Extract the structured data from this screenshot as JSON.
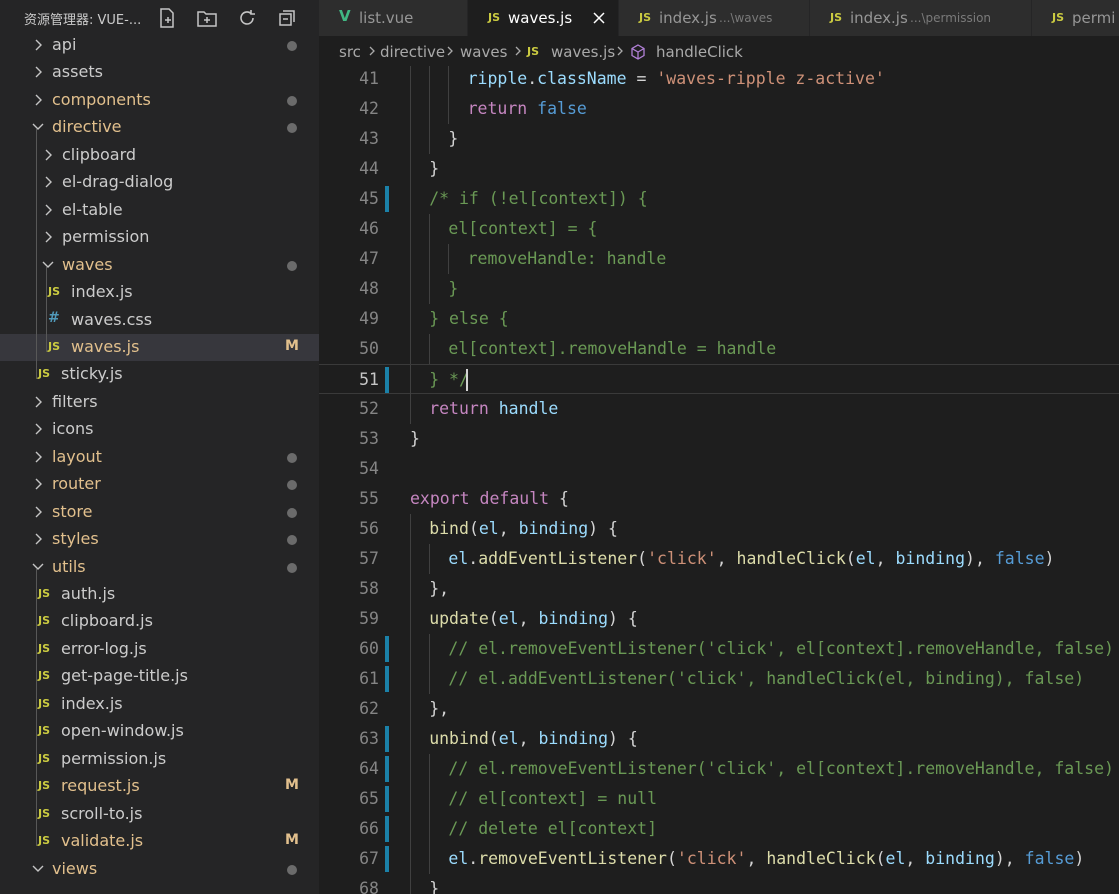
{
  "sidebar": {
    "title": "资源管理器: VUE-...",
    "tree": [
      {
        "label": "api",
        "type": "folder",
        "open": false,
        "depth": 1,
        "status": "dot"
      },
      {
        "label": "assets",
        "type": "folder",
        "open": false,
        "depth": 1,
        "status": ""
      },
      {
        "label": "components",
        "type": "folder",
        "open": false,
        "depth": 1,
        "status": "dot",
        "modified": true
      },
      {
        "label": "directive",
        "type": "folder",
        "open": true,
        "depth": 1,
        "status": "dot",
        "modified": true
      },
      {
        "label": "clipboard",
        "type": "folder",
        "open": false,
        "depth": 2,
        "status": ""
      },
      {
        "label": "el-drag-dialog",
        "type": "folder",
        "open": false,
        "depth": 2,
        "status": ""
      },
      {
        "label": "el-table",
        "type": "folder",
        "open": false,
        "depth": 2,
        "status": ""
      },
      {
        "label": "permission",
        "type": "folder",
        "open": false,
        "depth": 2,
        "status": ""
      },
      {
        "label": "waves",
        "type": "folder",
        "open": true,
        "depth": 2,
        "status": "dot",
        "modified": true
      },
      {
        "label": "index.js",
        "type": "js",
        "depth": 3,
        "status": ""
      },
      {
        "label": "waves.css",
        "type": "css",
        "depth": 3,
        "status": ""
      },
      {
        "label": "waves.js",
        "type": "js",
        "depth": 3,
        "status": "M",
        "modified": true,
        "selected": true
      },
      {
        "label": "sticky.js",
        "type": "js",
        "depth": 2,
        "status": ""
      },
      {
        "label": "filters",
        "type": "folder",
        "open": false,
        "depth": 1,
        "status": ""
      },
      {
        "label": "icons",
        "type": "folder",
        "open": false,
        "depth": 1,
        "status": ""
      },
      {
        "label": "layout",
        "type": "folder",
        "open": false,
        "depth": 1,
        "status": "dot",
        "modified": true
      },
      {
        "label": "router",
        "type": "folder",
        "open": false,
        "depth": 1,
        "status": "dot",
        "modified": true
      },
      {
        "label": "store",
        "type": "folder",
        "open": false,
        "depth": 1,
        "status": "dot",
        "modified": true
      },
      {
        "label": "styles",
        "type": "folder",
        "open": false,
        "depth": 1,
        "status": "dot",
        "modified": true
      },
      {
        "label": "utils",
        "type": "folder",
        "open": true,
        "depth": 1,
        "status": "dot",
        "modified": true
      },
      {
        "label": "auth.js",
        "type": "js",
        "depth": 2,
        "status": ""
      },
      {
        "label": "clipboard.js",
        "type": "js",
        "depth": 2,
        "status": ""
      },
      {
        "label": "error-log.js",
        "type": "js",
        "depth": 2,
        "status": ""
      },
      {
        "label": "get-page-title.js",
        "type": "js",
        "depth": 2,
        "status": ""
      },
      {
        "label": "index.js",
        "type": "js",
        "depth": 2,
        "status": ""
      },
      {
        "label": "open-window.js",
        "type": "js",
        "depth": 2,
        "status": ""
      },
      {
        "label": "permission.js",
        "type": "js",
        "depth": 2,
        "status": ""
      },
      {
        "label": "request.js",
        "type": "js",
        "depth": 2,
        "status": "M",
        "modified": true
      },
      {
        "label": "scroll-to.js",
        "type": "js",
        "depth": 2,
        "status": ""
      },
      {
        "label": "validate.js",
        "type": "js",
        "depth": 2,
        "status": "M",
        "modified": true
      },
      {
        "label": "views",
        "type": "folder",
        "open": true,
        "depth": 1,
        "status": "dot",
        "modified": true
      }
    ]
  },
  "tabs": [
    {
      "label": "list.vue",
      "icon": "vue-icon",
      "desc": ""
    },
    {
      "label": "waves.js",
      "icon": "js-icon",
      "desc": "",
      "active": true
    },
    {
      "label": "index.js",
      "icon": "js-icon",
      "desc": "...\\waves"
    },
    {
      "label": "index.js",
      "icon": "js-icon",
      "desc": "...\\permission"
    },
    {
      "label": "permi",
      "icon": "js-icon",
      "desc": ""
    }
  ],
  "breadcrumb": {
    "parts": [
      "src",
      "directive",
      "waves",
      "waves.js",
      "handleClick"
    ]
  },
  "editor": {
    "current_line": 51,
    "lines": [
      {
        "n": "41",
        "indent": 3,
        "mark": false,
        "tokens": [
          [
            "v",
            "ripple"
          ],
          [
            "p",
            "."
          ],
          [
            "v",
            "className"
          ],
          [
            "p",
            " = "
          ],
          [
            "s",
            "'waves-ripple z-active'"
          ]
        ]
      },
      {
        "n": "42",
        "indent": 3,
        "mark": false,
        "tokens": [
          [
            "k",
            "return"
          ],
          [
            "p",
            " "
          ],
          [
            "kb",
            "false"
          ]
        ]
      },
      {
        "n": "43",
        "indent": 2,
        "mark": false,
        "tokens": [
          [
            "p",
            "}"
          ]
        ]
      },
      {
        "n": "44",
        "indent": 1,
        "mark": false,
        "tokens": [
          [
            "p",
            "}"
          ]
        ]
      },
      {
        "n": "45",
        "indent": 1,
        "mark": true,
        "tokens": [
          [
            "c",
            "/* if (!el[context]) {"
          ]
        ]
      },
      {
        "n": "46",
        "indent": 2,
        "mark": false,
        "tokens": [
          [
            "c",
            "el[context] = {"
          ]
        ]
      },
      {
        "n": "47",
        "indent": 3,
        "mark": false,
        "tokens": [
          [
            "c",
            "removeHandle: handle"
          ]
        ]
      },
      {
        "n": "48",
        "indent": 2,
        "mark": false,
        "tokens": [
          [
            "c",
            "}"
          ]
        ]
      },
      {
        "n": "49",
        "indent": 1,
        "mark": false,
        "tokens": [
          [
            "c",
            "} else {"
          ]
        ]
      },
      {
        "n": "50",
        "indent": 2,
        "mark": false,
        "tokens": [
          [
            "c",
            "el[context].removeHandle = handle"
          ]
        ]
      },
      {
        "n": "51",
        "indent": 1,
        "mark": true,
        "tokens": [
          [
            "c",
            "} */"
          ]
        ]
      },
      {
        "n": "52",
        "indent": 1,
        "mark": false,
        "tokens": [
          [
            "k",
            "return"
          ],
          [
            "p",
            " "
          ],
          [
            "v",
            "handle"
          ]
        ]
      },
      {
        "n": "53",
        "indent": 0,
        "mark": false,
        "tokens": [
          [
            "p",
            "}"
          ]
        ]
      },
      {
        "n": "54",
        "indent": 0,
        "mark": false,
        "tokens": []
      },
      {
        "n": "55",
        "indent": 0,
        "mark": false,
        "tokens": [
          [
            "k",
            "export"
          ],
          [
            "p",
            " "
          ],
          [
            "k",
            "default"
          ],
          [
            "p",
            " {"
          ]
        ]
      },
      {
        "n": "56",
        "indent": 1,
        "mark": false,
        "tokens": [
          [
            "f",
            "bind"
          ],
          [
            "p",
            "("
          ],
          [
            "v",
            "el"
          ],
          [
            "p",
            ", "
          ],
          [
            "v",
            "binding"
          ],
          [
            "p",
            ") {"
          ]
        ]
      },
      {
        "n": "57",
        "indent": 2,
        "mark": false,
        "tokens": [
          [
            "v",
            "el"
          ],
          [
            "p",
            "."
          ],
          [
            "f",
            "addEventListener"
          ],
          [
            "p",
            "("
          ],
          [
            "s",
            "'click'"
          ],
          [
            "p",
            ", "
          ],
          [
            "f",
            "handleClick"
          ],
          [
            "p",
            "("
          ],
          [
            "v",
            "el"
          ],
          [
            "p",
            ", "
          ],
          [
            "v",
            "binding"
          ],
          [
            "p",
            "), "
          ],
          [
            "kb",
            "false"
          ],
          [
            "p",
            ")"
          ]
        ]
      },
      {
        "n": "58",
        "indent": 1,
        "mark": false,
        "tokens": [
          [
            "p",
            "},"
          ]
        ]
      },
      {
        "n": "59",
        "indent": 1,
        "mark": false,
        "tokens": [
          [
            "f",
            "update"
          ],
          [
            "p",
            "("
          ],
          [
            "v",
            "el"
          ],
          [
            "p",
            ", "
          ],
          [
            "v",
            "binding"
          ],
          [
            "p",
            ") {"
          ]
        ]
      },
      {
        "n": "60",
        "indent": 2,
        "mark": true,
        "tokens": [
          [
            "c",
            "// el.removeEventListener('click', el[context].removeHandle, false)"
          ]
        ]
      },
      {
        "n": "61",
        "indent": 2,
        "mark": true,
        "tokens": [
          [
            "c",
            "// el.addEventListener('click', handleClick(el, binding), false)"
          ]
        ]
      },
      {
        "n": "62",
        "indent": 1,
        "mark": false,
        "tokens": [
          [
            "p",
            "},"
          ]
        ]
      },
      {
        "n": "63",
        "indent": 1,
        "mark": true,
        "tokens": [
          [
            "f",
            "unbind"
          ],
          [
            "p",
            "("
          ],
          [
            "v",
            "el"
          ],
          [
            "p",
            ", "
          ],
          [
            "v",
            "binding"
          ],
          [
            "p",
            ") {"
          ]
        ]
      },
      {
        "n": "64",
        "indent": 2,
        "mark": true,
        "tokens": [
          [
            "c",
            "// el.removeEventListener('click', el[context].removeHandle, false)"
          ]
        ]
      },
      {
        "n": "65",
        "indent": 2,
        "mark": true,
        "tokens": [
          [
            "c",
            "// el[context] = null"
          ]
        ]
      },
      {
        "n": "66",
        "indent": 2,
        "mark": true,
        "tokens": [
          [
            "c",
            "// delete el[context]"
          ]
        ]
      },
      {
        "n": "67",
        "indent": 2,
        "mark": true,
        "tokens": [
          [
            "v",
            "el"
          ],
          [
            "p",
            "."
          ],
          [
            "f",
            "removeEventListener"
          ],
          [
            "p",
            "("
          ],
          [
            "s",
            "'click'"
          ],
          [
            "p",
            ", "
          ],
          [
            "f",
            "handleClick"
          ],
          [
            "p",
            "("
          ],
          [
            "v",
            "el"
          ],
          [
            "p",
            ", "
          ],
          [
            "v",
            "binding"
          ],
          [
            "p",
            "), "
          ],
          [
            "kb",
            "false"
          ],
          [
            "p",
            ")"
          ]
        ]
      },
      {
        "n": "68",
        "indent": 1,
        "mark": false,
        "tokens": [
          [
            "p",
            "}"
          ]
        ]
      }
    ]
  },
  "colors": {
    "accent": "#1b81a8",
    "modified": "#e2c08d",
    "js": "#cbcb41",
    "css": "#519aba",
    "vue": "#41b883"
  }
}
